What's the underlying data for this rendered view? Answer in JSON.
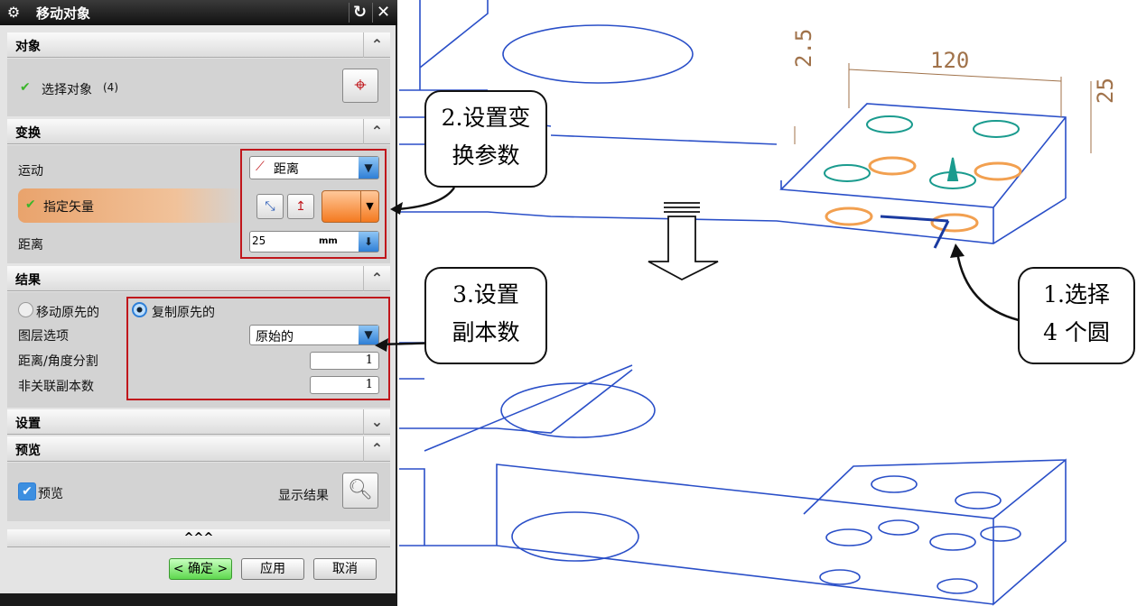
{
  "dialog": {
    "title": "移动对象",
    "sections": {
      "object": {
        "header": "对象",
        "select_label": "选择对象",
        "select_count": "(4)"
      },
      "transform": {
        "header": "变换",
        "motion_label": "运动",
        "motion_value": "距离",
        "vector_label": "指定矢量",
        "distance_label": "距离",
        "distance_value": "25",
        "distance_unit": "mm"
      },
      "result": {
        "header": "结果",
        "move_original": "移动原先的",
        "copy_original": "复制原先的",
        "layer_label": "图层选项",
        "layer_value": "原始的",
        "split_label": "距离/角度分割",
        "split_value": "1",
        "copies_label": "非关联副本数",
        "copies_value": "1"
      },
      "settings": {
        "header": "设置"
      },
      "preview": {
        "header": "预览",
        "preview_label": "预览",
        "show_result": "显示结果"
      }
    },
    "more_label": "^^^",
    "buttons": {
      "ok": "< 确定 >",
      "apply": "应用",
      "cancel": "取消"
    }
  },
  "callouts": {
    "step2": [
      "2.设置变",
      "换参数"
    ],
    "step3": [
      "3.设置",
      "副本数"
    ],
    "step1": [
      "1.选择",
      "4 个圆"
    ]
  },
  "dimensions": {
    "d1": "2.5",
    "d2": "120",
    "d3": "25"
  }
}
